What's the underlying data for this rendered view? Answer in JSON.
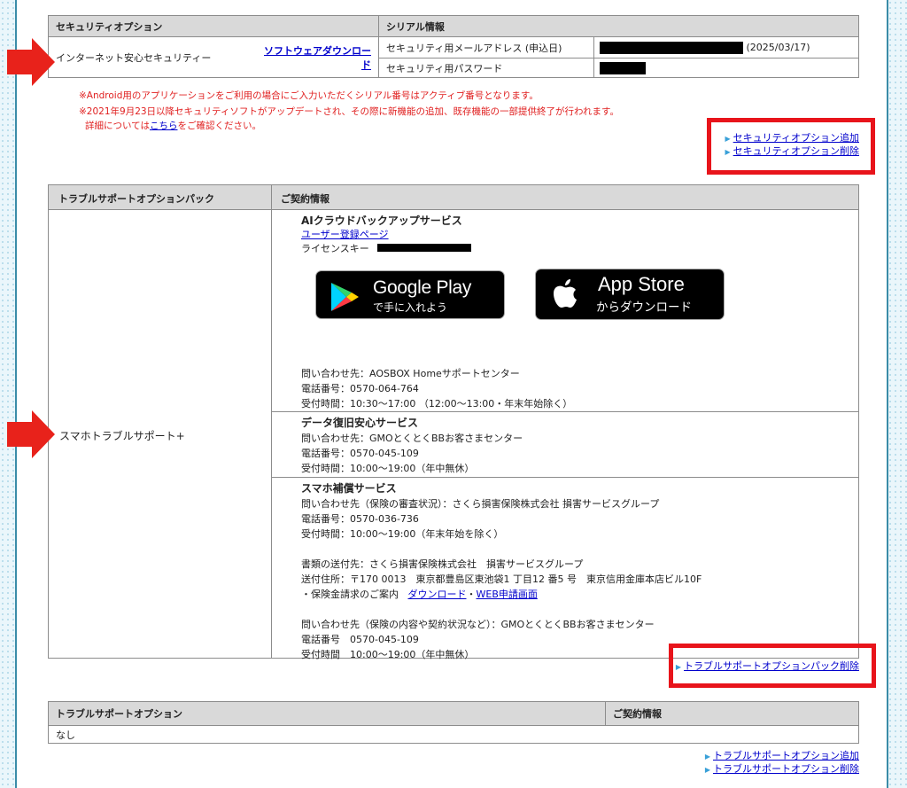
{
  "security_table": {
    "header_option": "セキュリティオプション",
    "header_serial": "シリアル情報",
    "option_name": "インターネット安心セキュリティー",
    "download_link": "ソフトウェアダウンロード",
    "mail_label": "セキュリティ用メールアドレス (申込日)",
    "mail_date": "(2025/03/17)",
    "password_label": "セキュリティ用パスワード"
  },
  "notes": [
    "※Android用のアプリケーションをご利用の場合にご入力いただくシリアル番号はアクティブ番号となります。",
    "※2021年9月23日以降セキュリティソフトがアップデートされ、その際に新機能の追加、既存機能の一部提供終了が行われます。"
  ],
  "note_detail_prefix": "詳細については",
  "note_detail_link": "こちら",
  "note_detail_suffix": "をご確認ください。",
  "security_links": {
    "add": "セキュリティオプション追加",
    "remove": "セキュリティオプション削除"
  },
  "trouble_pack": {
    "header_pack": "トラブルサポートオプションパック",
    "header_contract": "ご契約情報",
    "pack_name": "スマホトラブルサポート+",
    "ai": {
      "title": "AIクラウドバックアップサービス",
      "register_link": "ユーザー登録ページ",
      "license_label": "ライセンスキー",
      "google_line1": "Google Play",
      "google_line2": "で手に入れよう",
      "apple_line1": "App Store",
      "apple_line2": "からダウンロード",
      "contact": "問い合わせ先：AOSBOX Homeサポートセンター",
      "phone": "電話番号：0570-064-764",
      "hours": "受付時間：10:30～17:00 （12:00～13:00・年末年始除く）"
    },
    "data": {
      "title": "データ復旧安心サービス",
      "contact": "問い合わせ先：GMOとくとくBBお客さまセンター",
      "phone": "電話番号：0570-045-109",
      "hours": "受付時間：10:00～19:00（年中無休）"
    },
    "hosho": {
      "title": "スマホ補償サービス",
      "contact": "問い合わせ先（保険の審査状況）：さくら損害保険株式会社 損害サービスグループ",
      "phone": "電話番号：0570-036-736",
      "hours": "受付時間：10:00～19:00（年末年始を除く）",
      "send_to": "書類の送付先：さくら損害保険株式会社　損害サービスグループ",
      "address": "送付住所：〒170 0013　東京都豊島区東池袋1 丁目12 番5 号　東京信用金庫本店ビル10F",
      "claim_prefix": "・保険金請求のご案内",
      "download_link": "ダウンロード",
      "separator": "・",
      "web_link": "WEB申請画面",
      "contact2": "問い合わせ先（保険の内容や契約状況など）：GMOとくとくBBお客さまセンター",
      "phone2": "電話番号　0570-045-109",
      "hours2": "受付時間　10:00～19:00（年中無休）"
    },
    "remove_link": "トラブルサポートオプションパック削除"
  },
  "trouble_option": {
    "header_option": "トラブルサポートオプション",
    "header_contract": "ご契約情報",
    "value": "なし",
    "add_link": "トラブルサポートオプション追加",
    "remove_link": "トラブルサポートオプション削除"
  },
  "colors": {
    "annotation_red": "#e8141b",
    "link": "#0000cc",
    "header_bg": "#d9d9d9",
    "frame": "#3a8ca8"
  }
}
